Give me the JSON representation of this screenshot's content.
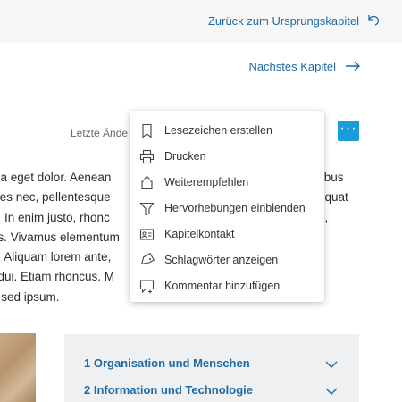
{
  "nav": {
    "back_label": "Zurück zum Ursprungskapitel",
    "next_label": "Nächstes Kapitel"
  },
  "meta": {
    "last_changed_label": "Letzte Ände"
  },
  "content": {
    "lines": [
      {
        "left": "ula eget dolor. Aenean",
        "right": "tibus"
      },
      {
        "left": "cies nec, pellentesque",
        "right": "equat"
      },
      {
        "left": "u. In enim justo, rhonc",
        "right": "e,"
      },
      {
        "left": "us. Vivamus elementum",
        "right": ""
      },
      {
        "left": "n. Aliquam lorem ante,",
        "right": ","
      },
      {
        "left": "t dui. Etiam rhoncus. M",
        "right": ""
      },
      {
        "left": "e sed ipsum.",
        "right": ""
      }
    ]
  },
  "menu": {
    "items": [
      {
        "label": "Lesezeichen erstellen",
        "icon": "bookmark-icon"
      },
      {
        "label": "Drucken",
        "icon": "printer-icon"
      },
      {
        "label": "Weiterempfehlen",
        "icon": "share-icon"
      },
      {
        "label": "Hervorhebungen einblenden",
        "icon": "highlighter-icon"
      },
      {
        "label": "Kapitelkontakt",
        "icon": "contact-card-icon"
      },
      {
        "label": "Schlagwörter anzeigen",
        "icon": "tag-icon"
      },
      {
        "label": "Kommentar hinzufügen",
        "icon": "comment-add-icon"
      }
    ]
  },
  "toc": {
    "items": [
      {
        "label": "1  Organisation und Menschen"
      },
      {
        "label": "2  Information und Technologie"
      }
    ]
  },
  "colors": {
    "accent": "#1f6aa5",
    "button": "#1a9bdb",
    "toc_bg": "#eef0f2"
  }
}
